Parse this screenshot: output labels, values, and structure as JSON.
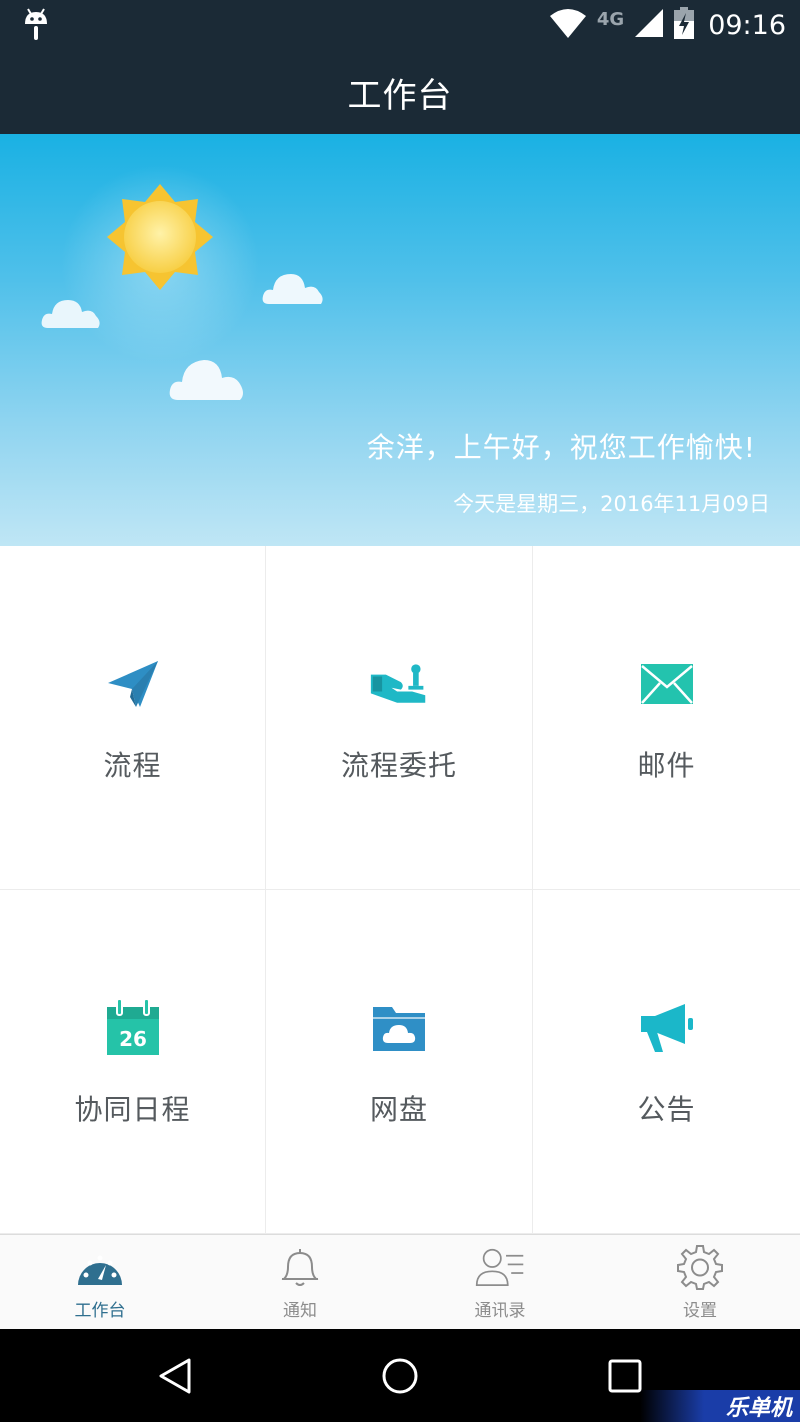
{
  "status_bar": {
    "network": "4G",
    "clock": "09:16",
    "icons": [
      "android-debug-icon",
      "wifi-icon",
      "signal-icon",
      "battery-charging-icon"
    ]
  },
  "app_bar": {
    "title": "工作台"
  },
  "banner": {
    "greeting": "余洋，上午好，祝您工作愉快!",
    "date_line": "今天是星期三，2016年11月09日",
    "icons": [
      "sun-icon",
      "cloud-icon"
    ]
  },
  "grid": {
    "items": [
      {
        "label": "流程",
        "icon": "paper-plane-icon",
        "color": "#2e8ec4"
      },
      {
        "label": "流程委托",
        "icon": "hand-delegate-icon",
        "color": "#1fb8c6"
      },
      {
        "label": "邮件",
        "icon": "envelope-icon",
        "color": "#23c3ae"
      },
      {
        "label": "协同日程",
        "icon": "calendar-icon",
        "color": "#25c3a8",
        "badge": "26"
      },
      {
        "label": "网盘",
        "icon": "cloud-folder-icon",
        "color": "#2f8fc6"
      },
      {
        "label": "公告",
        "icon": "megaphone-icon",
        "color": "#1bb7c9"
      }
    ]
  },
  "tab_bar": {
    "tabs": [
      {
        "label": "工作台",
        "icon": "dashboard-icon",
        "active": true
      },
      {
        "label": "通知",
        "icon": "bell-icon",
        "active": false
      },
      {
        "label": "通讯录",
        "icon": "contacts-icon",
        "active": false
      },
      {
        "label": "设置",
        "icon": "gear-icon",
        "active": false
      }
    ]
  },
  "nav_bar": {
    "icons": [
      "back-icon",
      "home-icon",
      "recents-icon"
    ]
  },
  "watermark": "乐单机",
  "colors": {
    "header_bg": "#1b2a36",
    "active_tab": "#2f6f8f",
    "banner_top": "#1ab1e3",
    "banner_bottom": "#bfe6f5"
  }
}
